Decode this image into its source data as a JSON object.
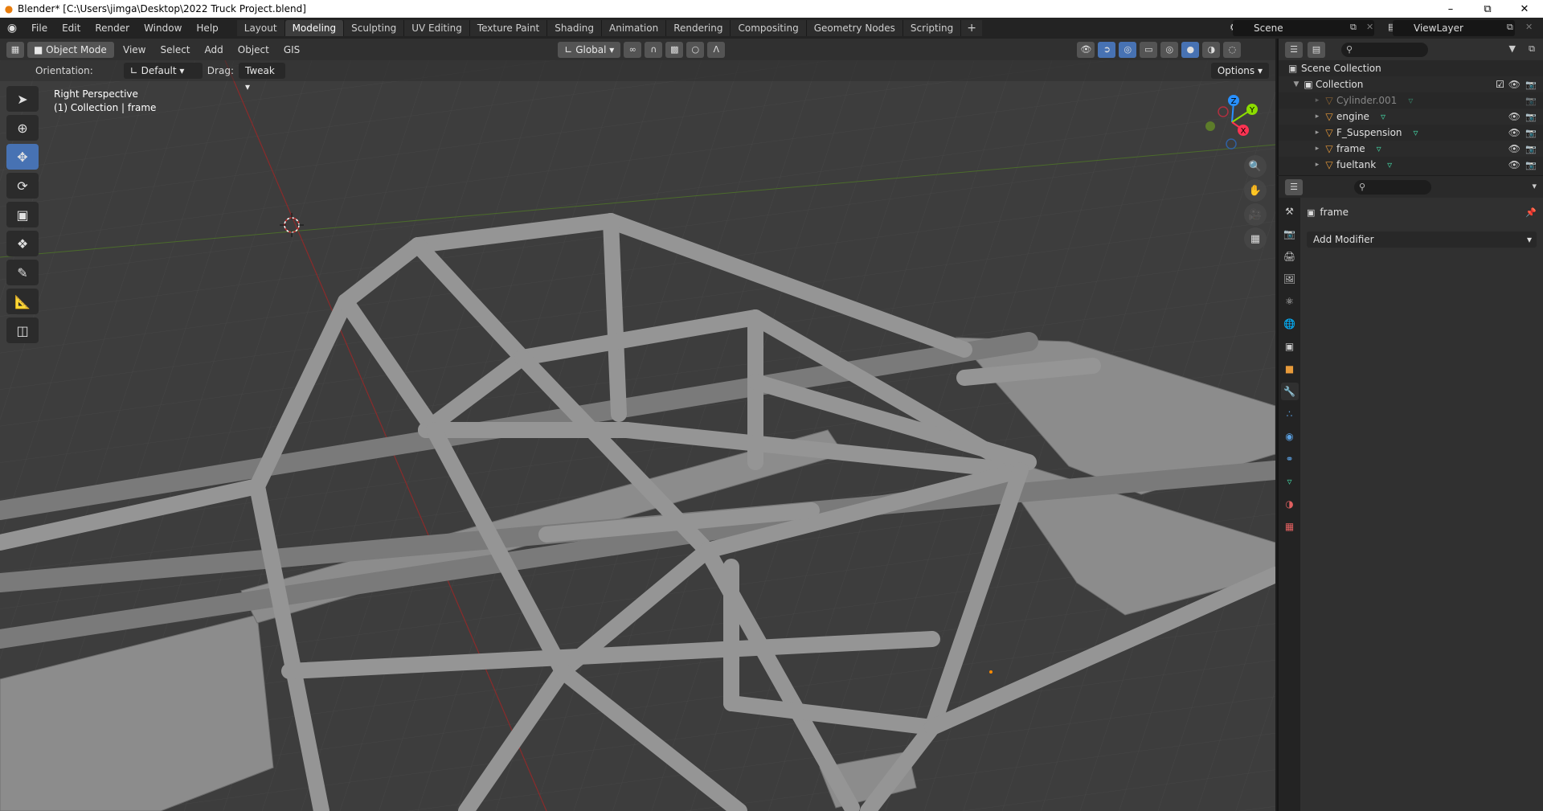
{
  "window": {
    "title": "Blender* [C:\\Users\\jimga\\Desktop\\2022 Truck Project.blend]",
    "minimize": "–",
    "maximize": "⧉",
    "close": "✕"
  },
  "menu": [
    "File",
    "Edit",
    "Render",
    "Window",
    "Help"
  ],
  "workspaces": [
    "Layout",
    "Modeling",
    "Sculpting",
    "UV Editing",
    "Texture Paint",
    "Shading",
    "Animation",
    "Rendering",
    "Compositing",
    "Geometry Nodes",
    "Scripting"
  ],
  "workspace_add": "+",
  "scene": {
    "name": "Scene",
    "view_layer": "ViewLayer"
  },
  "viewport_header": {
    "mode": "Object Mode",
    "menus": [
      "View",
      "Select",
      "Add",
      "Object",
      "GIS"
    ],
    "transform_orientation": "Global"
  },
  "tool_settings": {
    "orientation_label": "Orientation:",
    "orientation_value": "Default",
    "drag_label": "Drag:",
    "drag_value": "Tweak",
    "options": "Options"
  },
  "viewport_overlay": {
    "view_name": "Right Perspective",
    "context": "(1) Collection | frame"
  },
  "gizmo_axes": {
    "z": "Z",
    "y": "Y",
    "x": "X"
  },
  "outliner": {
    "scene_collection": "Scene Collection",
    "collection": "Collection",
    "items": [
      {
        "name": "Cylinder.001",
        "dimmed": true
      },
      {
        "name": "engine",
        "dimmed": false
      },
      {
        "name": "F_Suspension",
        "dimmed": false
      },
      {
        "name": "frame",
        "dimmed": false
      },
      {
        "name": "fueltank",
        "dimmed": false
      }
    ]
  },
  "properties": {
    "object_name": "frame",
    "add_modifier": "Add Modifier"
  },
  "colors": {
    "accent": "#4772b3",
    "object_orange": "#e89b3a",
    "mesh_green": "#42c79a",
    "axis_x": "#ff3352",
    "axis_y": "#8bdc00",
    "axis_z": "#2890ff"
  }
}
